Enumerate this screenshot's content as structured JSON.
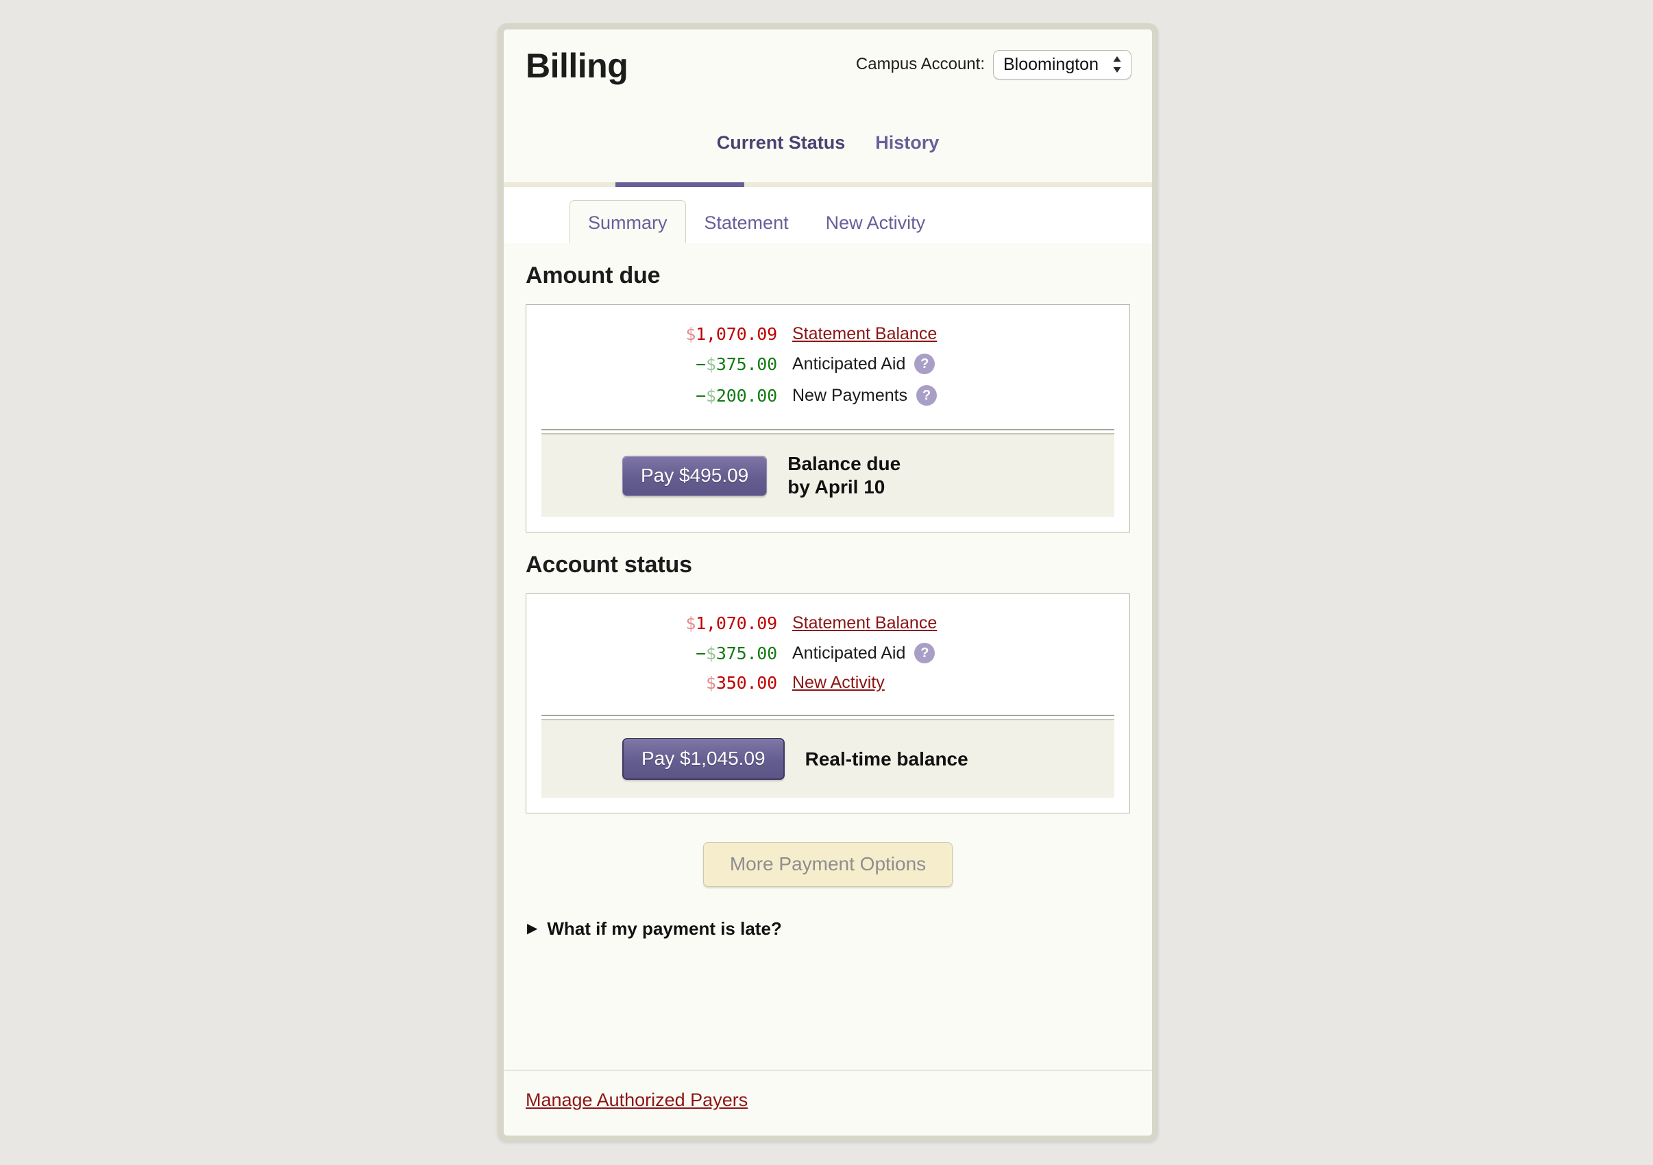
{
  "header": {
    "title": "Billing",
    "campus_label": "Campus Account:",
    "campus_value": "Bloomington",
    "stepper_icon": "up-down-chevron-icon"
  },
  "primary_tabs": [
    {
      "label": "Current Status",
      "active": true
    },
    {
      "label": "History",
      "active": false
    }
  ],
  "sub_tabs": [
    {
      "label": "Summary",
      "active": true
    },
    {
      "label": "Statement",
      "active": false
    },
    {
      "label": "New Activity",
      "active": false
    }
  ],
  "amount_due": {
    "section_title": "Amount due",
    "rows": [
      {
        "currency": "$",
        "amount": "1,070.09",
        "sign": "",
        "kind": "debit",
        "label": "Statement Balance",
        "is_link": true,
        "help": false
      },
      {
        "currency": "$",
        "amount": "375.00",
        "sign": "−",
        "kind": "credit",
        "label": "Anticipated Aid",
        "is_link": false,
        "help": true,
        "help_icon": "question-mark-icon"
      },
      {
        "currency": "$",
        "amount": "200.00",
        "sign": "−",
        "kind": "credit",
        "label": "New Payments",
        "is_link": false,
        "help": true,
        "help_icon": "question-mark-icon"
      }
    ],
    "pay_button": "Pay $495.09",
    "total_line1": "Balance due",
    "total_line2": "by April 10"
  },
  "account_status": {
    "section_title": "Account status",
    "rows": [
      {
        "currency": "$",
        "amount": "1,070.09",
        "sign": "",
        "kind": "debit",
        "label": "Statement Balance",
        "is_link": true,
        "help": false
      },
      {
        "currency": "$",
        "amount": "375.00",
        "sign": "−",
        "kind": "credit",
        "label": "Anticipated Aid",
        "is_link": false,
        "help": true,
        "help_icon": "question-mark-icon"
      },
      {
        "currency": "$",
        "amount": "350.00",
        "sign": "",
        "kind": "debit",
        "label": "New Activity",
        "is_link": true,
        "help": false
      }
    ],
    "pay_button": "Pay $1,045.09",
    "total_line1": "Real-time balance"
  },
  "more_payment_options": "More Payment Options",
  "disclosure": {
    "triangle_icon": "triangle-right-icon",
    "label": "What if my payment is late?"
  },
  "footer": {
    "link": "Manage Authorized Payers"
  },
  "colors": {
    "accent_purple": "#675f99",
    "link_red": "#8c1515",
    "debit_red": "#c00000",
    "credit_green": "#147a14",
    "page_bg": "#e8e7e3",
    "card_bg": "#fbfbf5",
    "card_border": "#d8d5c9",
    "total_strip_bg": "#f2f1e7",
    "more_btn_bg": "#f6edcd",
    "help_badge_bg": "#a99fc6"
  }
}
